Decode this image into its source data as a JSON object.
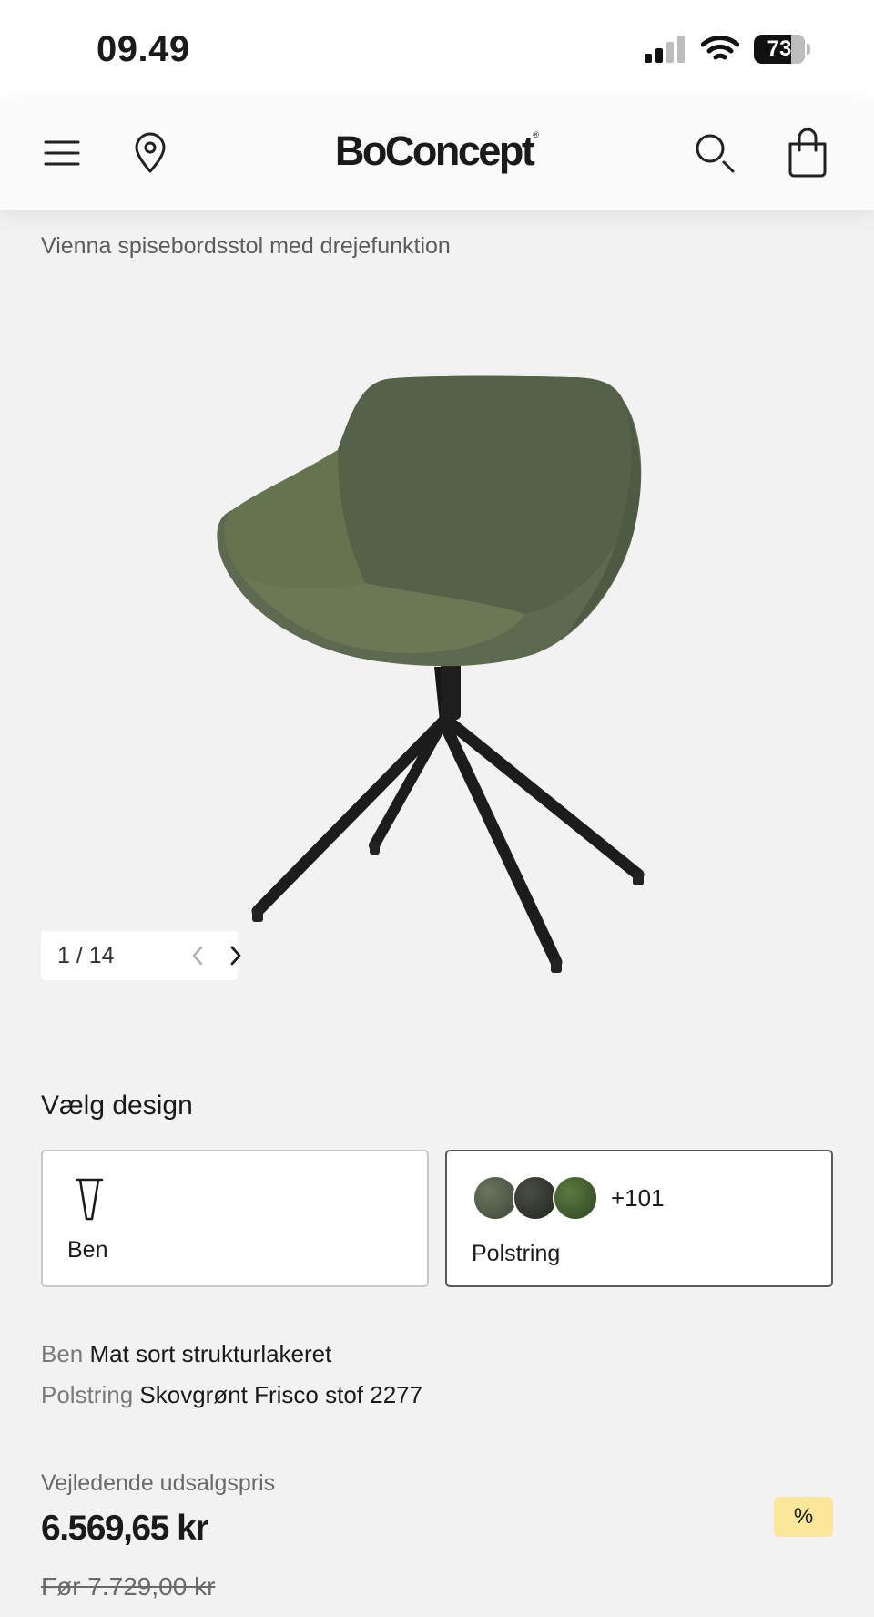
{
  "status_bar": {
    "time": "09.49",
    "battery": "73"
  },
  "nav": {
    "logo": "BoConcept",
    "logo_mark": "®",
    "icons": [
      "menu-icon",
      "location-pin-icon",
      "search-icon",
      "shopping-bag-icon"
    ]
  },
  "product": {
    "title": "Vienna spisebordsstol med drejefunktion",
    "image_icon": "swivel-dining-chair",
    "gallery": {
      "counter": "1 / 14"
    }
  },
  "design": {
    "heading": "Vælg design",
    "options": [
      {
        "label": "Ben",
        "icon": "chair-leg-icon"
      },
      {
        "label": "Polstring",
        "more_count": "+101",
        "swatch_colors": [
          "#4a5440",
          "#2f322b",
          "#3f5a2c"
        ]
      }
    ]
  },
  "specs": [
    {
      "key": "Ben",
      "value": "Mat sort strukturlakeret"
    },
    {
      "key": "Polstring",
      "value": "Skovgrønt Frisco stof 2277"
    }
  ],
  "pricing": {
    "label": "Vejledende udsalgspris",
    "price": "6.569,65 kr",
    "old_price": "Før 7.729,00 kr",
    "discount_badge": "%"
  },
  "colors": {
    "badge": "#fbe79a",
    "chair_fabric": "#5d6a50",
    "chair_frame": "#1e1e1e"
  }
}
